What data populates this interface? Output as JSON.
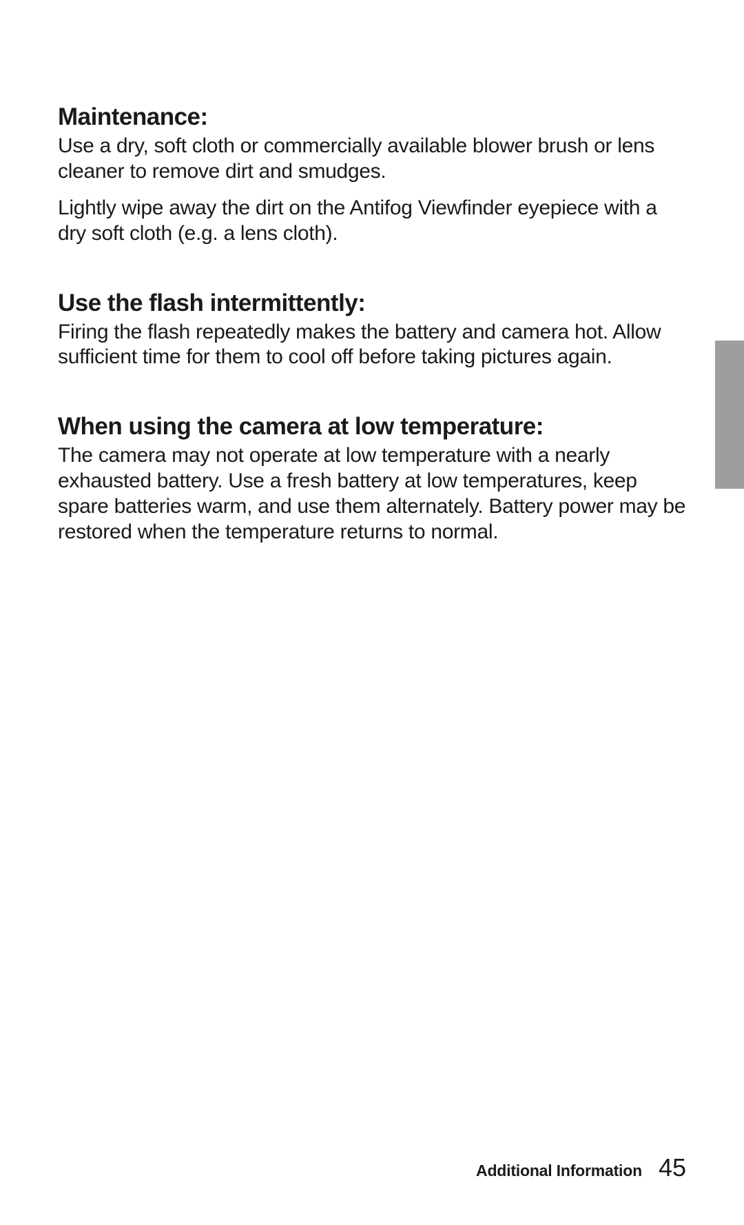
{
  "sections": [
    {
      "heading": "Maintenance:",
      "paragraphs": [
        "Use a dry, soft cloth or commercially available blower brush or lens cleaner to remove dirt and smudges.",
        "Lightly wipe away the dirt on the Antifog Viewfinder eyepiece with a dry soft cloth (e.g. a lens cloth)."
      ]
    },
    {
      "heading": "Use the flash intermittently:",
      "paragraphs": [
        "Firing the flash repeatedly makes the battery and camera hot. Allow sufficient time for them to cool off before taking pictures again."
      ]
    },
    {
      "heading": "When using the camera at low temperature:",
      "paragraphs": [
        "The camera may not operate at low temperature with a nearly exhausted battery. Use a fresh battery at low temperatures, keep spare batteries warm, and use them alternately.\nBattery power may be restored when the temperature returns to normal."
      ]
    }
  ],
  "footer": {
    "label": "Additional Information",
    "page_number": "45"
  }
}
